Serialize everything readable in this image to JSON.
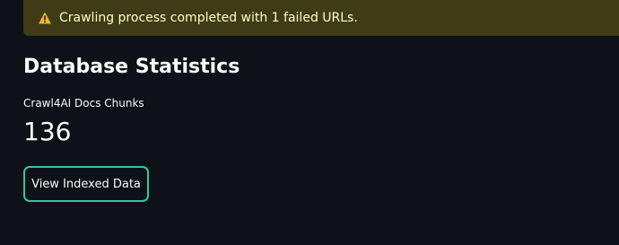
{
  "alert": {
    "icon": "warning-icon",
    "message": "Crawling process completed with 1 failed URLs.",
    "background": "#3e3b16",
    "text_color": "#fdfdc9",
    "icon_color": "#f0b429"
  },
  "stats": {
    "heading": "Database Statistics",
    "metric_label": "Crawl4AI Docs Chunks",
    "metric_value": "136"
  },
  "actions": {
    "view_button_label": "View Indexed Data",
    "accent_color": "#2fc99b"
  }
}
